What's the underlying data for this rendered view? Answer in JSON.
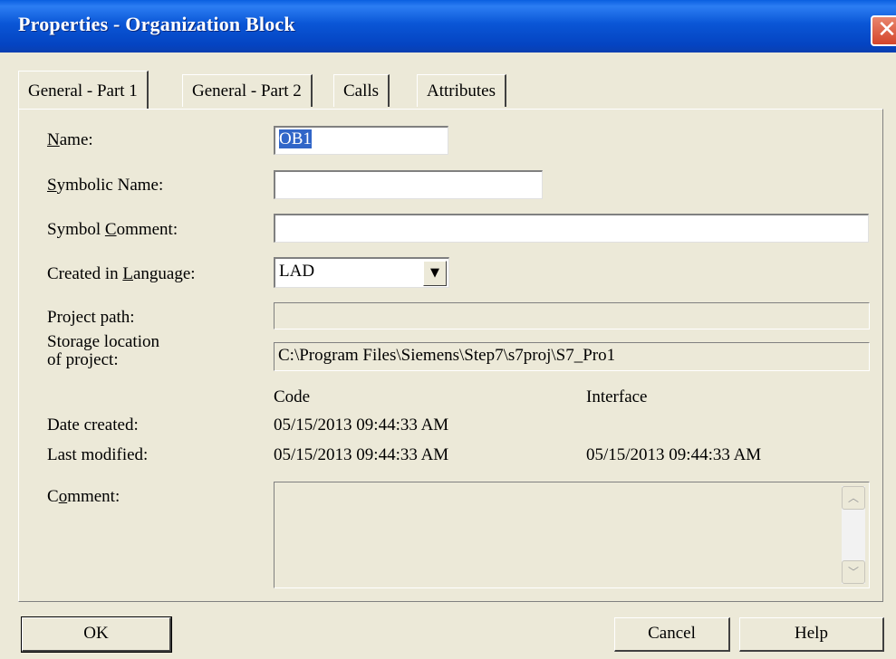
{
  "window": {
    "title": "Properties - Organization Block",
    "close_glyph": "✕",
    "close_icon": "close-icon"
  },
  "tabs": [
    {
      "label": "General - Part 1",
      "active": true
    },
    {
      "label": "General - Part 2",
      "active": false
    },
    {
      "label": "Calls",
      "active": false
    },
    {
      "label": "Attributes",
      "active": false
    }
  ],
  "form": {
    "name": {
      "label_pre": "",
      "label_ul": "N",
      "label_post": "ame:",
      "value": "OB1"
    },
    "symbolic_name": {
      "label_pre": "",
      "label_ul": "S",
      "label_post": "ymbolic Name:",
      "value": ""
    },
    "symbol_comment": {
      "label_pre": "Symbol ",
      "label_ul": "C",
      "label_post": "omment:",
      "value": ""
    },
    "language": {
      "label_pre": "Created in ",
      "label_ul": "L",
      "label_post": "anguage:",
      "value": "LAD",
      "arrow_icon": "dropdown-arrow-icon",
      "arrow_glyph": "▼"
    },
    "project_path": {
      "label": "Project path:",
      "value": ""
    },
    "storage": {
      "label_line1": "Storage location",
      "label_line2": "of project:",
      "value": "C:\\Program Files\\Siemens\\Step7\\s7proj\\S7_Pro1"
    }
  },
  "dates": {
    "col_code": "Code",
    "col_interface": "Interface",
    "created_label": "Date created:",
    "created_code": "05/15/2013 09:44:33 AM",
    "modified_label": "Last modified:",
    "modified_code": "05/15/2013 09:44:33 AM",
    "modified_interface": "05/15/2013 09:44:33 AM"
  },
  "comment": {
    "label_pre": "C",
    "label_ul": "o",
    "label_post": "mment:",
    "value": "",
    "scroll_up_glyph": "︿",
    "scroll_down_glyph": "﹀"
  },
  "buttons": {
    "ok": "OK",
    "cancel": "Cancel",
    "help": "Help"
  }
}
